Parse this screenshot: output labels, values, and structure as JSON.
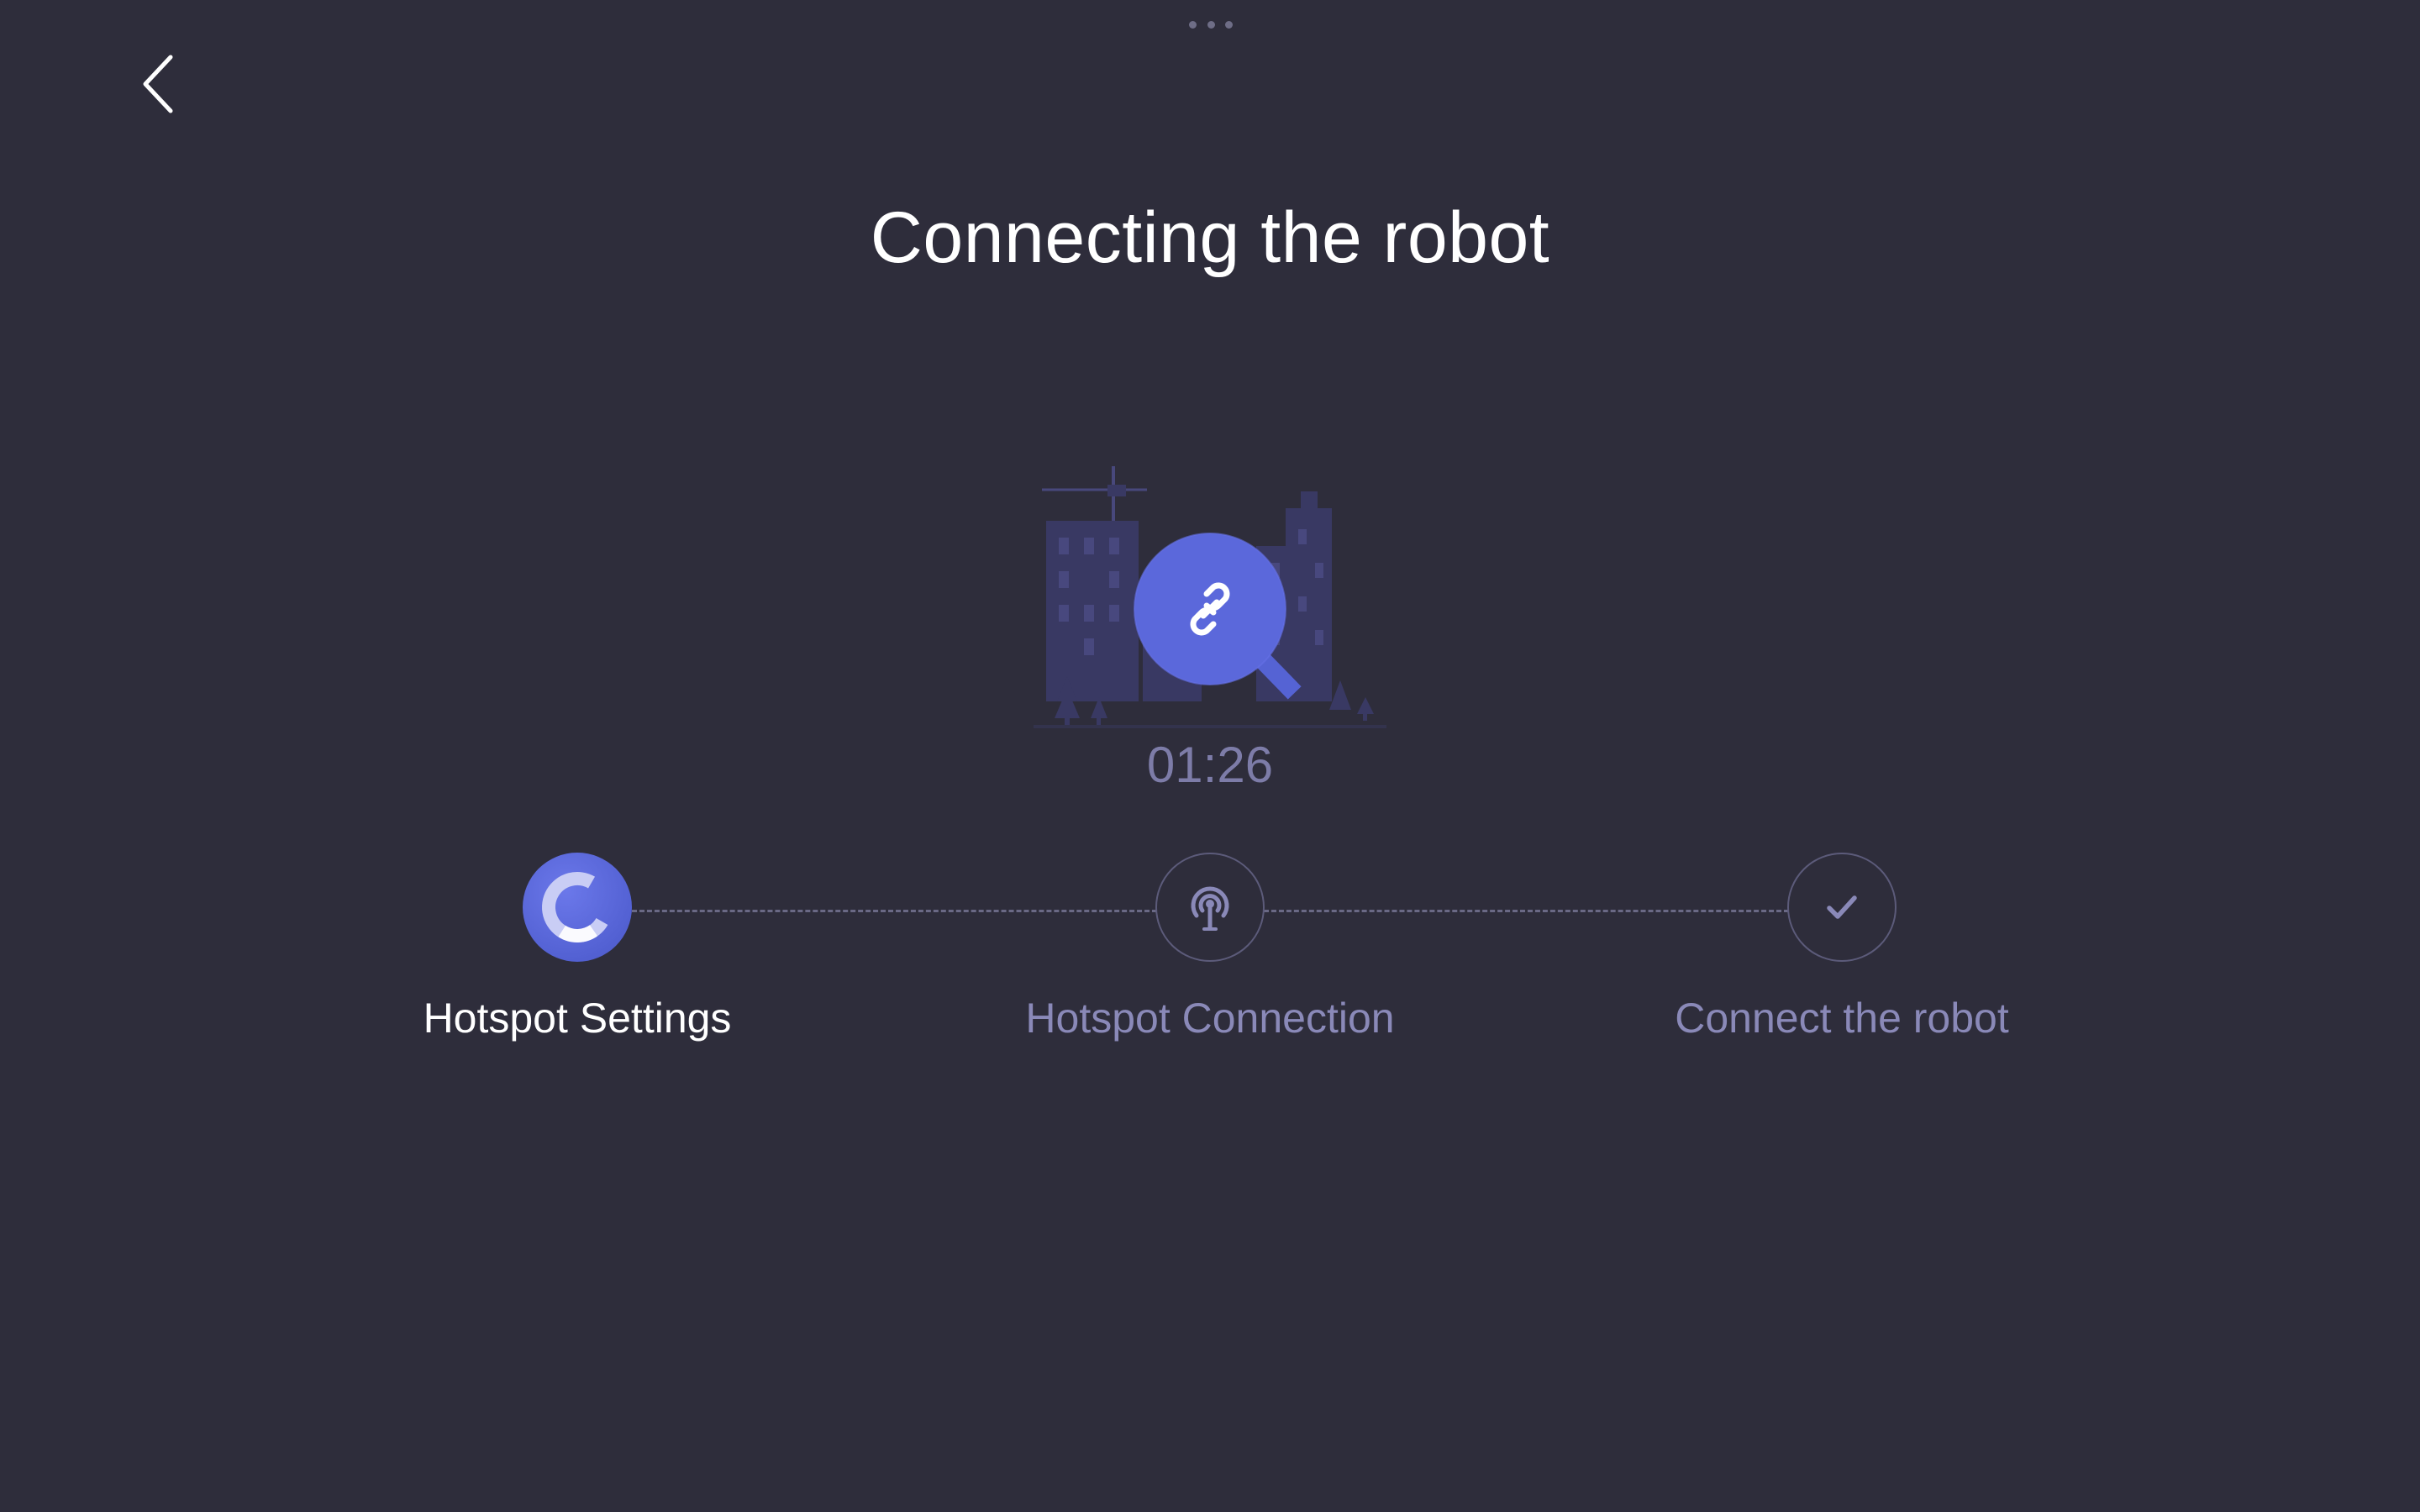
{
  "header": {
    "title": "Connecting the robot",
    "back_icon": "chevron-left-icon",
    "menu_icon": "more-dots-icon"
  },
  "status": {
    "illustration_icon": "link-search-icon",
    "timer": "01:26"
  },
  "steps": [
    {
      "label": "Hotspot Settings",
      "state": "active",
      "icon": "loading-spinner-icon"
    },
    {
      "label": "Hotspot Connection",
      "state": "pending",
      "icon": "hotspot-antenna-icon"
    },
    {
      "label": "Connect the robot",
      "state": "pending",
      "icon": "checkmark-icon"
    }
  ],
  "colors": {
    "background": "#2e2d3b",
    "accent": "#5865d8",
    "active_text": "#ffffff",
    "pending_text": "#8a89b8",
    "timer_text": "#7d7ca8"
  }
}
